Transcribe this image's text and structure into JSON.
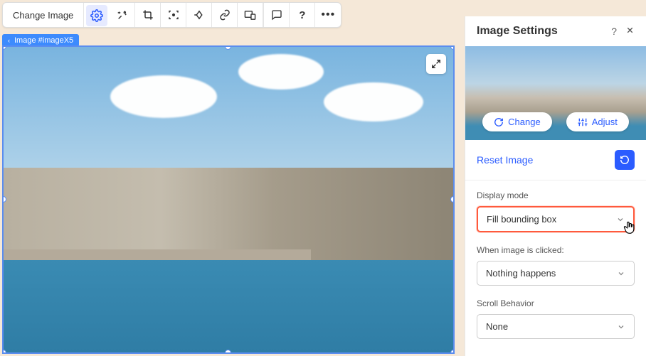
{
  "toolbar": {
    "change_image_label": "Change Image"
  },
  "breadcrumb": {
    "label": "Image #imageX5"
  },
  "panel": {
    "title": "Image Settings",
    "change_label": "Change",
    "adjust_label": "Adjust",
    "reset_label": "Reset Image",
    "display_mode_label": "Display mode",
    "display_mode_value": "Fill bounding box",
    "click_label": "When image is clicked:",
    "click_value": "Nothing happens",
    "scroll_label": "Scroll Behavior",
    "scroll_value": "None"
  }
}
